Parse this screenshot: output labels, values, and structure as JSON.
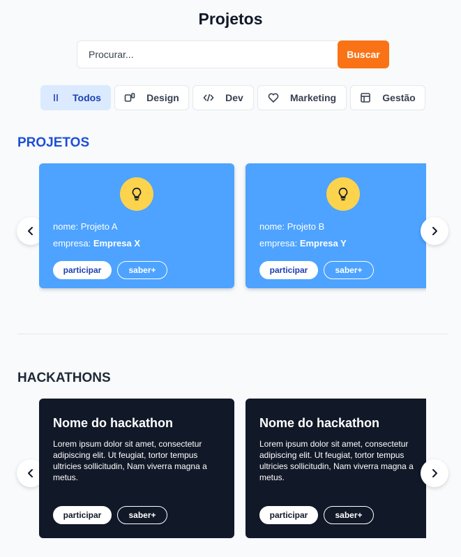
{
  "page": {
    "title": "Projetos"
  },
  "search": {
    "placeholder": "Procurar...",
    "button_label": "Buscar"
  },
  "filters": [
    {
      "label": "Todos",
      "icon": "bars-icon",
      "active": true
    },
    {
      "label": "Design",
      "icon": "design-icon",
      "active": false
    },
    {
      "label": "Dev",
      "icon": "code-icon",
      "active": false
    },
    {
      "label": "Marketing",
      "icon": "heart-icon",
      "active": false
    },
    {
      "label": "Gestão",
      "icon": "layout-icon",
      "active": false
    }
  ],
  "projetos": {
    "heading": "PROJETOS",
    "cards": [
      {
        "nome_label": "nome:",
        "nome": "Projeto A",
        "empresa_label": "empresa:",
        "empresa": "Empresa X",
        "primary_label": "participar",
        "secondary_label": "saber+"
      },
      {
        "nome_label": "nome:",
        "nome": "Projeto B",
        "empresa_label": "empresa:",
        "empresa": "Empresa Y",
        "primary_label": "participar",
        "secondary_label": "saber+"
      }
    ]
  },
  "hackathons": {
    "heading": "HACKATHONS",
    "cards": [
      {
        "title": "Nome do hackathon",
        "description": "Lorem ipsum dolor sit amet, consectetur adipiscing elit. Ut feugiat, tortor tempus ultricies sollicitudin, Nam viverra magna a metus.",
        "primary_label": "participar",
        "secondary_label": "saber+"
      },
      {
        "title": "Nome do hackathon",
        "description": "Lorem ipsum dolor sit amet, consectetur adipiscing elit. Ut feugiat, tortor tempus ultricies sollicitudin, Nam viverra magna a metus.",
        "primary_label": "participar",
        "secondary_label": "saber+"
      }
    ]
  },
  "colors": {
    "accent": "#f97316",
    "project_card": "#4da3ff",
    "hackathon_card": "#111827",
    "heading_blue": "#1d4ed8"
  }
}
